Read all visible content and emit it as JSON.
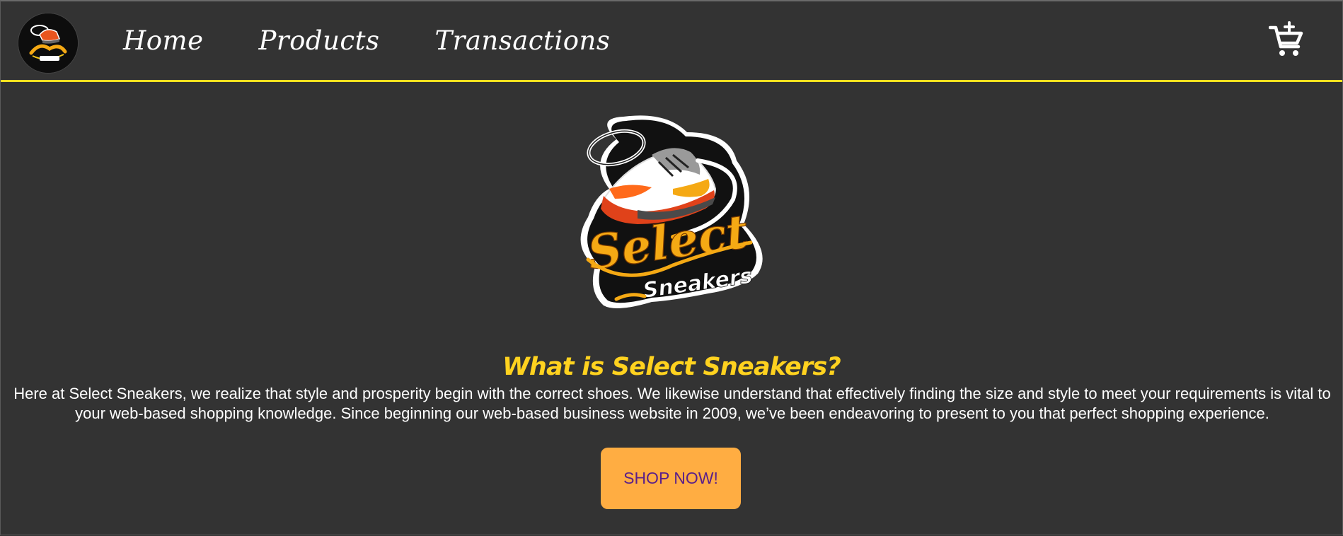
{
  "nav": {
    "brand_logo": "select-sneakers-logo",
    "links": [
      "Home",
      "Products",
      "Transactions"
    ],
    "cart_icon": "add-to-cart-icon"
  },
  "hero": {
    "logo": "select-sneakers-logo",
    "logo_text_main": "Select",
    "logo_text_sub": "Sneakers",
    "title": "What is Select Sneakers?",
    "description": "Here at Select Sneakers, we realize that style and prosperity begin with the correct shoes. We likewise understand that effectively finding the size and style to meet your requirements is vital to your web-based shopping knowledge. Since beginning our web-based business website in 2009, we’ve been endeavoring to present to you that perfect shopping experience.",
    "cta_label": "SHOP NOW!"
  },
  "colors": {
    "background": "#333333",
    "accent_line": "#ffe11f",
    "title": "#ffd21f",
    "button_bg": "#ffad42",
    "button_text": "#5a1f8a"
  }
}
